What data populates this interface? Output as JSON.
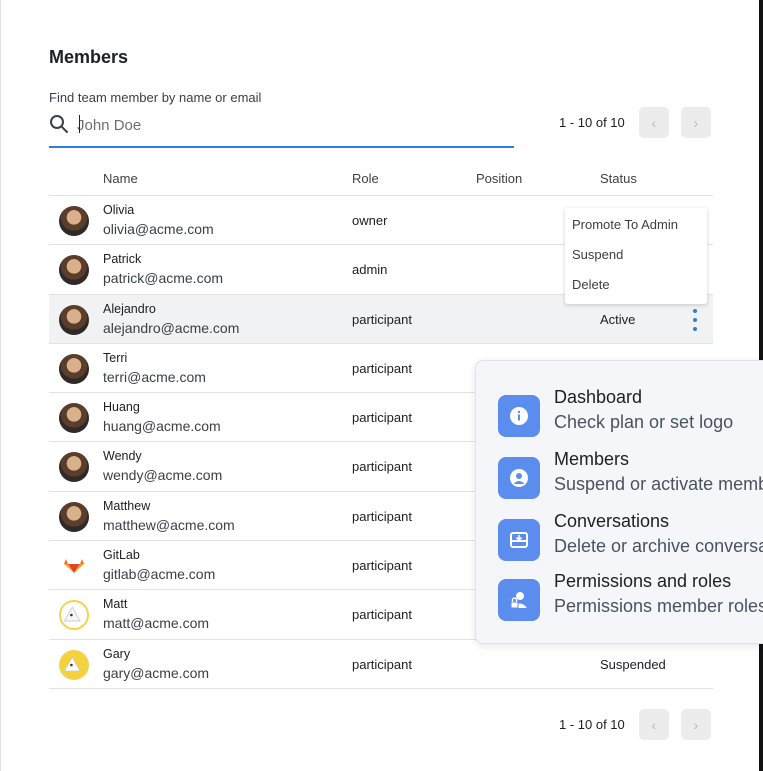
{
  "page": {
    "title": "Members"
  },
  "search": {
    "label": "Find team member by name or email",
    "placeholder": "John Doe"
  },
  "pagination": {
    "range_text": "1 - 10 of 10",
    "prev_icon": "chevron-left",
    "next_icon": "chevron-right"
  },
  "table": {
    "headers": {
      "name": "Name",
      "role": "Role",
      "position": "Position",
      "status": "Status"
    },
    "rows": [
      {
        "name": "Olivia",
        "email": "olivia@acme.com",
        "role": "owner",
        "position": "",
        "status": ""
      },
      {
        "name": "Patrick",
        "email": "patrick@acme.com",
        "role": "admin",
        "position": "",
        "status": ""
      },
      {
        "name": "Alejandro",
        "email": "alejandro@acme.com",
        "role": "participant",
        "position": "",
        "status": "Active"
      },
      {
        "name": "Terri",
        "email": "terri@acme.com",
        "role": "participant",
        "position": "",
        "status": ""
      },
      {
        "name": "Huang",
        "email": "huang@acme.com",
        "role": "participant",
        "position": "",
        "status": ""
      },
      {
        "name": "Wendy",
        "email": "wendy@acme.com",
        "role": "participant",
        "position": "",
        "status": ""
      },
      {
        "name": "Matthew",
        "email": "matthew@acme.com",
        "role": "participant",
        "position": "",
        "status": ""
      },
      {
        "name": "GitLab",
        "email": "gitlab@acme.com",
        "role": "participant",
        "position": "",
        "status": ""
      },
      {
        "name": "Matt",
        "email": "matt@acme.com",
        "role": "participant",
        "position": "",
        "status": ""
      },
      {
        "name": "Gary",
        "email": "gary@acme.com",
        "role": "participant",
        "position": "",
        "status": "Suspended"
      }
    ]
  },
  "context_menu": {
    "items": [
      "Promote To Admin",
      "Suspend",
      "Delete"
    ]
  },
  "nav_popover": {
    "items": [
      {
        "title": "Dashboard",
        "description": "Check plan or set logo",
        "icon": "info-icon"
      },
      {
        "title": "Members",
        "description": "Suspend or activate memb",
        "icon": "user-icon"
      },
      {
        "title": "Conversations",
        "description": "Delete or archive conversat",
        "icon": "inbox-icon"
      },
      {
        "title": "Permissions and roles",
        "description": "Permissions member roles",
        "icon": "user-lock-icon"
      }
    ]
  },
  "colors": {
    "accent": "#2f7de1",
    "icon_tile": "#5b8def",
    "row_highlight": "#f1f2f4"
  }
}
